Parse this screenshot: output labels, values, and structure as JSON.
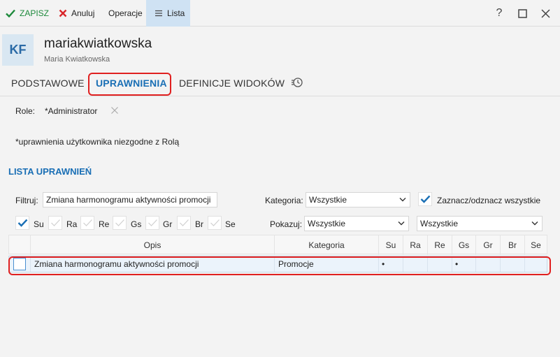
{
  "toolbar": {
    "save_label": "ZAPISZ",
    "cancel_label": "Anuluj",
    "operations_label": "Operacje",
    "list_label": "Lista",
    "help_label": "?"
  },
  "header": {
    "avatar_initials": "KF",
    "login": "mariakwiatkowska",
    "full_name": "Maria Kwiatkowska"
  },
  "tabs": [
    {
      "label": "PODSTAWOWE",
      "active": false
    },
    {
      "label": "UPRAWNIENIA",
      "active": true
    },
    {
      "label": "DEFINICJE WIDOKÓW",
      "active": false
    }
  ],
  "roles": {
    "label": "Role:",
    "value": "*Administrator"
  },
  "note": "*uprawnienia użytkownika niezgodne z Rolą",
  "section_title": "LISTA UPRAWNIEŃ",
  "filters": {
    "filter_label": "Filtruj:",
    "filter_value": "Zmiana harmonogramu aktywności promocji",
    "category_label": "Kategoria:",
    "category_value": "Wszystkie",
    "select_all_label": "Zaznacz/odznacz wszystkie",
    "select_all_checked": true,
    "show_label": "Pokazuj:",
    "show_value": "Wszystkie",
    "show_value2": "Wszystkie",
    "day_toggles": [
      {
        "label": "Su",
        "checked": true
      },
      {
        "label": "Ra",
        "checked": false
      },
      {
        "label": "Re",
        "checked": false
      },
      {
        "label": "Gs",
        "checked": false
      },
      {
        "label": "Gr",
        "checked": false
      },
      {
        "label": "Br",
        "checked": false
      },
      {
        "label": "Se",
        "checked": false
      }
    ]
  },
  "grid": {
    "columns": [
      "Opis",
      "Kategoria",
      "Su",
      "Ra",
      "Re",
      "Gs",
      "Gr",
      "Br",
      "Se"
    ],
    "rows": [
      {
        "description": "Zmiana harmonogramu aktywności promocji",
        "category": "Promocje",
        "marks": [
          "•",
          "",
          "",
          "•",
          "",
          "",
          ""
        ]
      }
    ]
  },
  "colors": {
    "accent": "#1a6fb5",
    "save_green": "#1e8a3c",
    "highlight_red": "#e02020",
    "selected_row": "#ebf3fb"
  }
}
